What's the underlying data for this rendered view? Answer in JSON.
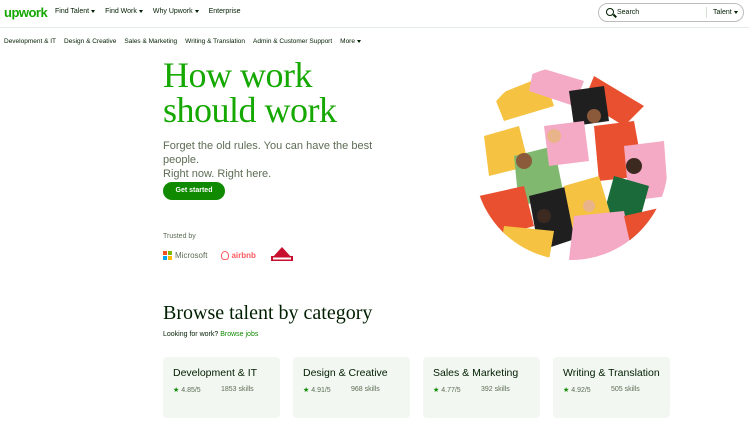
{
  "nav": {
    "logo": "upwork",
    "links": [
      "Find Talent",
      "Find Work",
      "Why Upwork",
      "Enterprise"
    ],
    "search_placeholder": "Search",
    "search_scope": "Talent"
  },
  "categories_nav": [
    "Development & IT",
    "Design & Creative",
    "Sales & Marketing",
    "Writing & Translation",
    "Admin & Customer Support",
    "More"
  ],
  "hero": {
    "title_line1": "How work",
    "title_line2": "should work",
    "subtitle_line1": "Forget the old rules. You can have the best people.",
    "subtitle_line2": "Right now. Right here.",
    "cta": "Get started",
    "trusted_by": "Trusted by",
    "logos": [
      "Microsoft",
      "airbnb",
      "BISSELL"
    ]
  },
  "browse": {
    "title": "Browse talent by category",
    "sub_text": "Looking for work?",
    "sub_link": "Browse jobs",
    "cards": [
      {
        "title": "Development & IT",
        "rating": "4.85/5",
        "skills": "1853 skills"
      },
      {
        "title": "Design & Creative",
        "rating": "4.91/5",
        "skills": "968 skills"
      },
      {
        "title": "Sales & Marketing",
        "rating": "4.77/5",
        "skills": "392 skills"
      },
      {
        "title": "Writing & Translation",
        "rating": "4.92/5",
        "skills": "505 skills"
      }
    ]
  },
  "colors": {
    "brand_green": "#14a800",
    "button_green": "#108a00",
    "card_bg": "#f2f7f2"
  }
}
